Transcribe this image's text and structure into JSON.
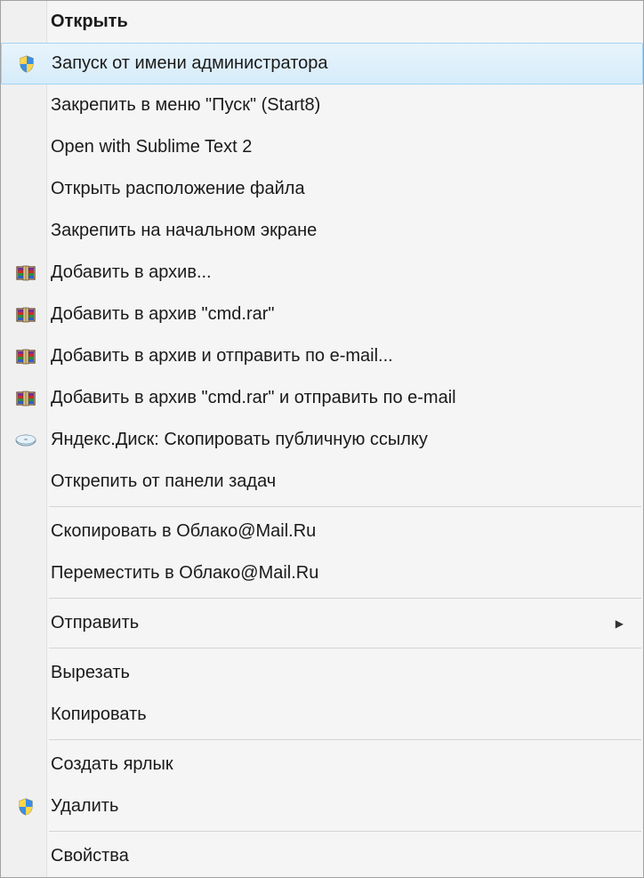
{
  "menu": {
    "items": [
      {
        "label": "Открыть",
        "bold": true
      },
      {
        "label": "Запуск от имени администратора",
        "icon": "shield",
        "highlighted": true
      },
      {
        "label": "Закрепить в меню \"Пуск\" (Start8)"
      },
      {
        "label": "Open with Sublime Text 2"
      },
      {
        "label": "Открыть расположение файла"
      },
      {
        "label": "Закрепить на начальном экране"
      },
      {
        "label": "Добавить в архив...",
        "icon": "winrar"
      },
      {
        "label": "Добавить в архив \"cmd.rar\"",
        "icon": "winrar"
      },
      {
        "label": "Добавить в архив и отправить по e-mail...",
        "icon": "winrar"
      },
      {
        "label": "Добавить в архив \"cmd.rar\" и отправить по e-mail",
        "icon": "winrar"
      },
      {
        "label": "Яндекс.Диск: Скопировать публичную ссылку",
        "icon": "disk"
      },
      {
        "label": "Открепить от панели задач"
      },
      {
        "separator": true
      },
      {
        "label": "Скопировать в Облако@Mail.Ru"
      },
      {
        "label": "Переместить в Облако@Mail.Ru"
      },
      {
        "separator": true
      },
      {
        "label": "Отправить",
        "submenu": true
      },
      {
        "separator": true
      },
      {
        "label": "Вырезать"
      },
      {
        "label": "Копировать"
      },
      {
        "separator": true
      },
      {
        "label": "Создать ярлык"
      },
      {
        "label": "Удалить",
        "icon": "shield"
      },
      {
        "separator": true
      },
      {
        "label": "Свойства"
      }
    ]
  }
}
